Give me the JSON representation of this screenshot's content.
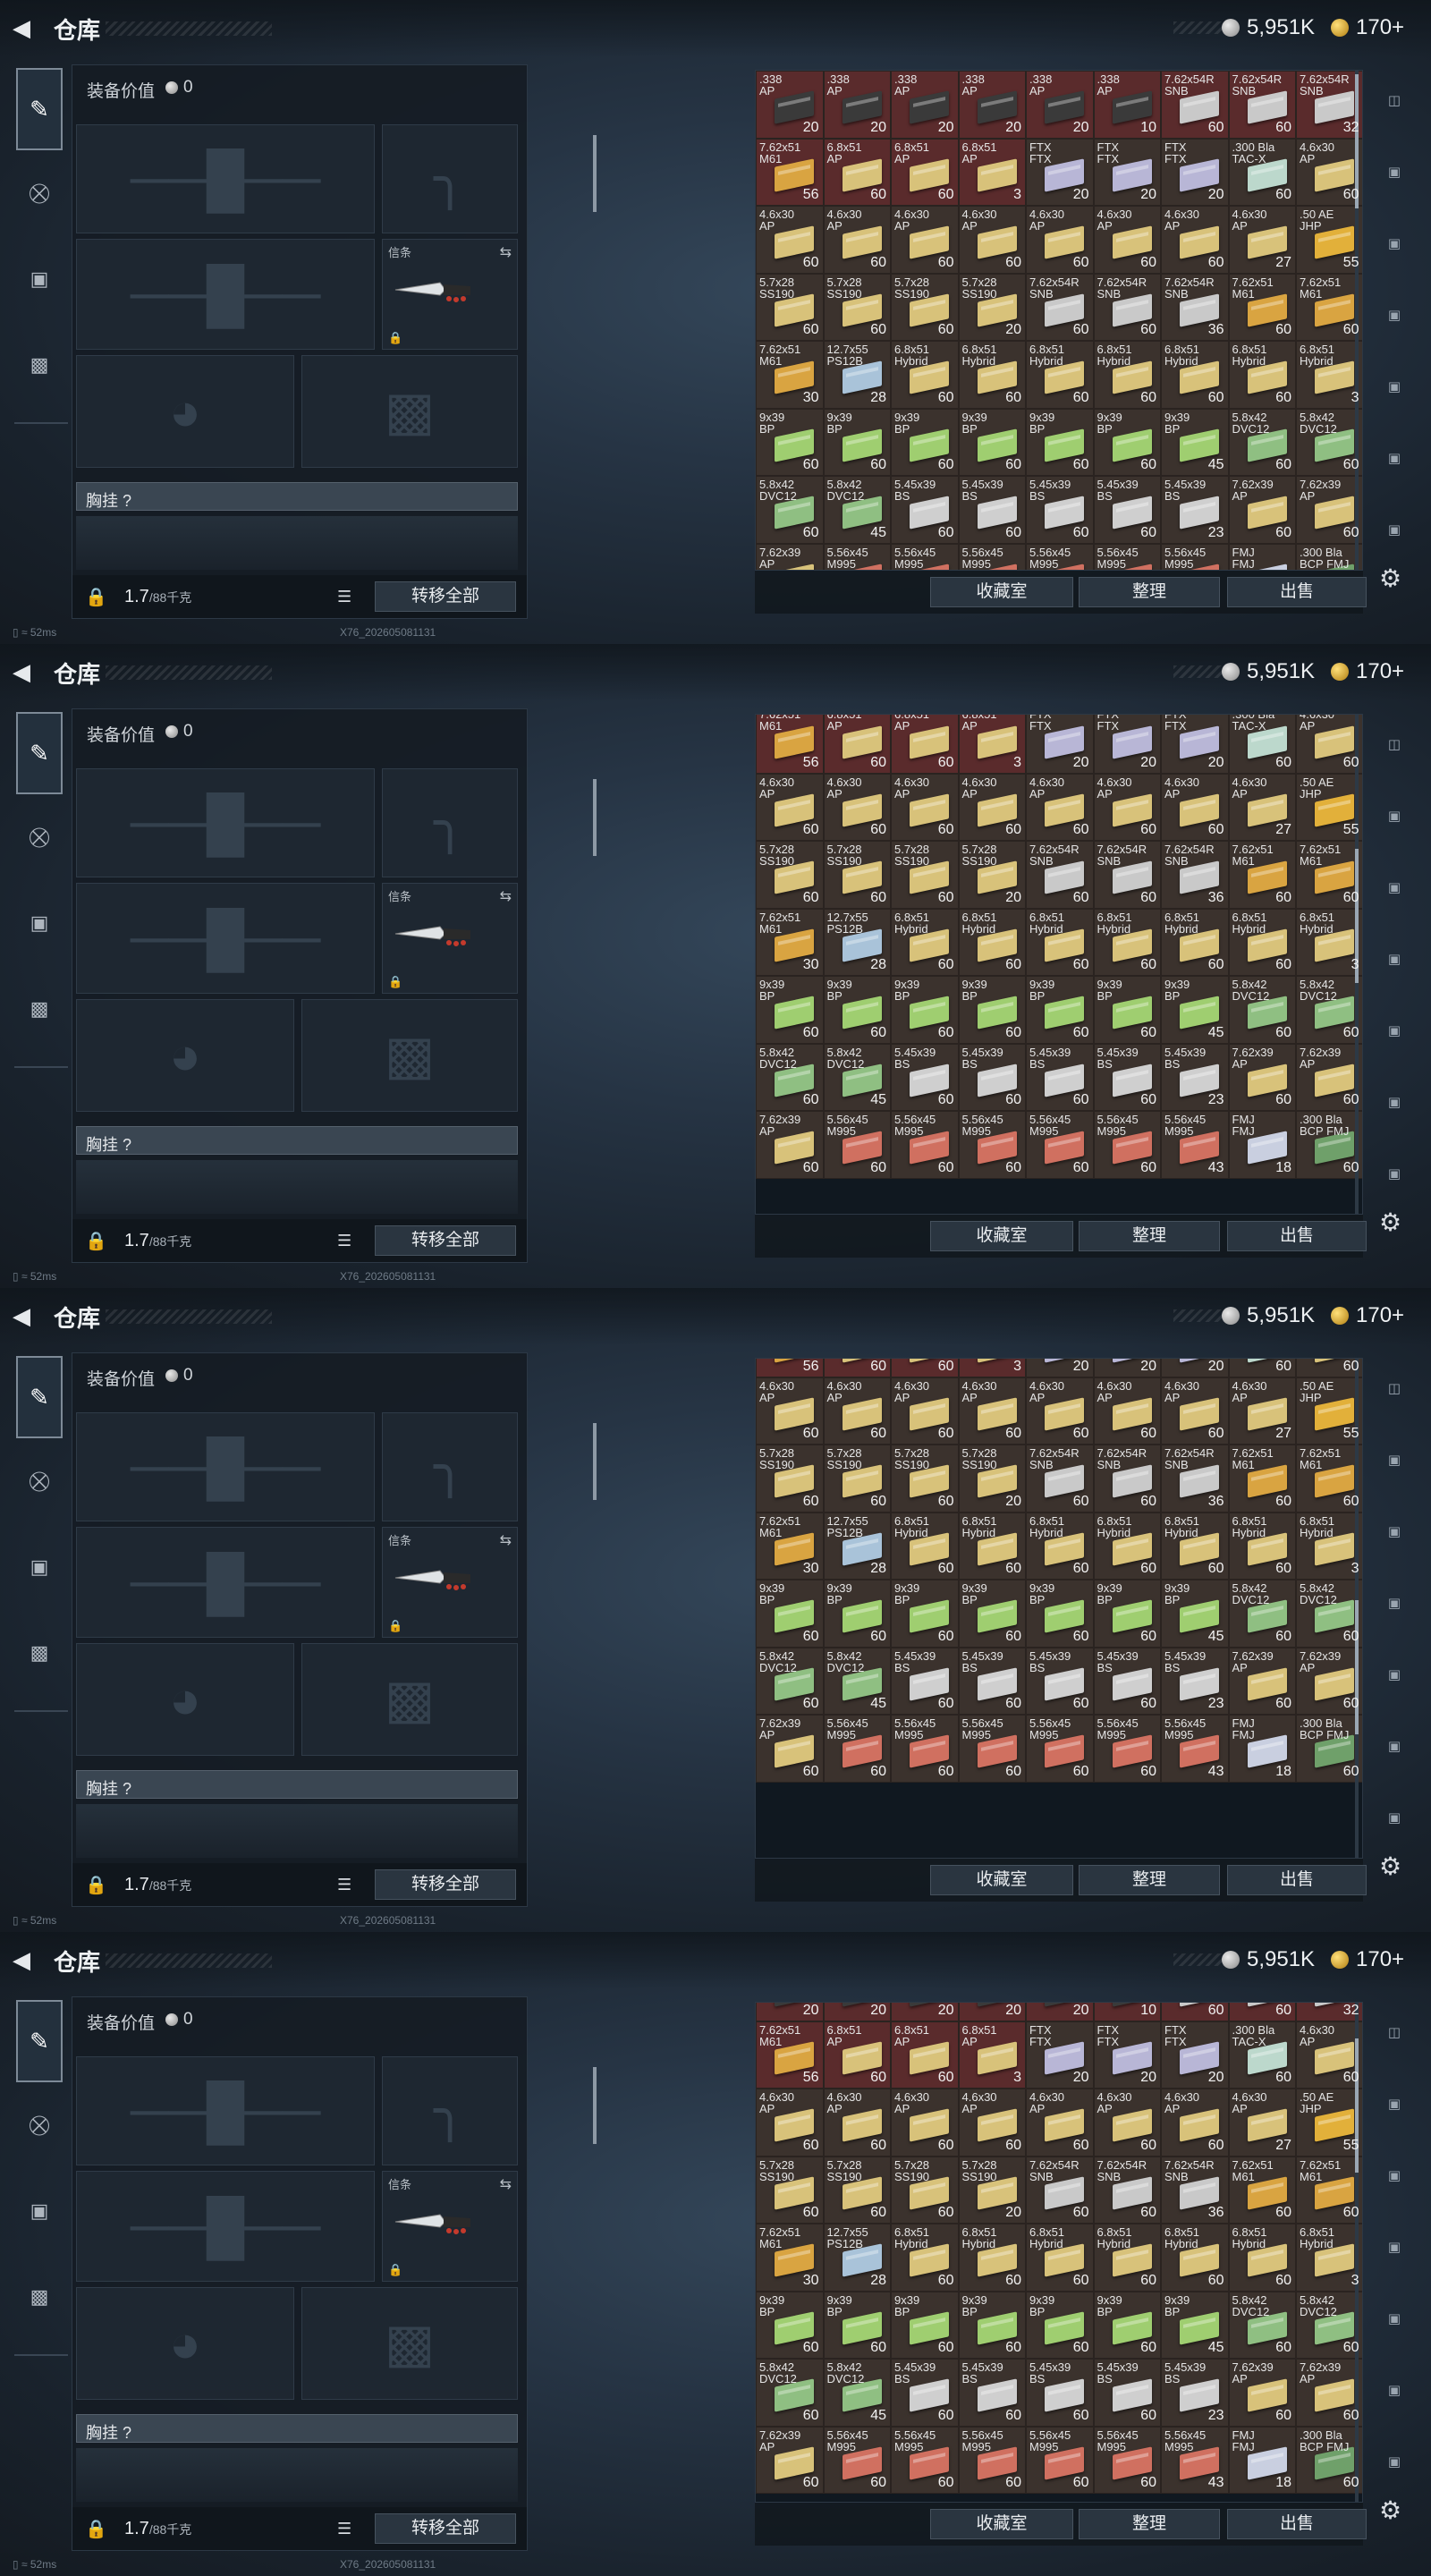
{
  "header": {
    "title": "仓库",
    "silver": "5,951K",
    "gold": "170+"
  },
  "equipment": {
    "value_label": "装备价值",
    "value": "0",
    "melee_tag": "信条",
    "rig_label": "胸挂",
    "rig_help": "?",
    "weight": "1.7",
    "weight_cap": "/88千克",
    "transfer_all": "转移全部"
  },
  "stash_actions": {
    "favorites": "收藏室",
    "sort": "整理",
    "sell": "出售"
  },
  "status": {
    "ping": "52ms",
    "version": "X76_202605081131"
  },
  "items": [
    {
      "n": ".338\nAP",
      "q": "20",
      "c": "#3a3a3a",
      "r": true
    },
    {
      "n": ".338\nAP",
      "q": "20",
      "c": "#3a3a3a",
      "r": true
    },
    {
      "n": ".338\nAP",
      "q": "20",
      "c": "#3a3a3a",
      "r": true
    },
    {
      "n": ".338\nAP",
      "q": "20",
      "c": "#3a3a3a",
      "r": true
    },
    {
      "n": ".338\nAP",
      "q": "20",
      "c": "#3a3a3a",
      "r": true
    },
    {
      "n": ".338\nAP",
      "q": "10",
      "c": "#3a3a3a",
      "r": true
    },
    {
      "n": "7.62x54R\nSNB",
      "q": "60",
      "c": "#c9c9c9",
      "r": true
    },
    {
      "n": "7.62x54R\nSNB",
      "q": "60",
      "c": "#c9c9c9",
      "r": true
    },
    {
      "n": "7.62x54R\nSNB",
      "q": "32",
      "c": "#c9c9c9",
      "r": true
    },
    {
      "n": "7.62x51\nM61",
      "q": "56",
      "c": "#d9a441",
      "r": true
    },
    {
      "n": "6.8x51\nAP",
      "q": "60",
      "c": "#d8c27a",
      "r": true
    },
    {
      "n": "6.8x51\nAP",
      "q": "60",
      "c": "#d8c27a",
      "r": true
    },
    {
      "n": "6.8x51\nAP",
      "q": "3",
      "c": "#d8c27a",
      "r": true
    },
    {
      "n": "FTX\nFTX",
      "q": "20",
      "c": "#b8b6d6",
      "r": false
    },
    {
      "n": "FTX\nFTX",
      "q": "20",
      "c": "#b8b6d6",
      "r": false
    },
    {
      "n": "FTX\nFTX",
      "q": "20",
      "c": "#b8b6d6",
      "r": false
    },
    {
      "n": ".300 Bla\nTAC-X",
      "q": "60",
      "c": "#bcd8cc",
      "r": false
    },
    {
      "n": "4.6x30\nAP",
      "q": "60",
      "c": "#d8c27a",
      "r": false
    },
    {
      "n": "4.6x30\nAP",
      "q": "60",
      "c": "#d8c27a",
      "r": false
    },
    {
      "n": "4.6x30\nAP",
      "q": "60",
      "c": "#d8c27a",
      "r": false
    },
    {
      "n": "4.6x30\nAP",
      "q": "60",
      "c": "#d8c27a",
      "r": false
    },
    {
      "n": "4.6x30\nAP",
      "q": "60",
      "c": "#d8c27a",
      "r": false
    },
    {
      "n": "4.6x30\nAP",
      "q": "60",
      "c": "#d8c27a",
      "r": false
    },
    {
      "n": "4.6x30\nAP",
      "q": "60",
      "c": "#d8c27a",
      "r": false
    },
    {
      "n": "4.6x30\nAP",
      "q": "60",
      "c": "#d8c27a",
      "r": false
    },
    {
      "n": "4.6x30\nAP",
      "q": "27",
      "c": "#d8c27a",
      "r": false
    },
    {
      "n": ".50 AE\nJHP",
      "q": "55",
      "c": "#e2b03a",
      "r": false
    },
    {
      "n": "5.7x28\nSS190",
      "q": "60",
      "c": "#d8c27a",
      "r": false
    },
    {
      "n": "5.7x28\nSS190",
      "q": "60",
      "c": "#d8c27a",
      "r": false
    },
    {
      "n": "5.7x28\nSS190",
      "q": "60",
      "c": "#d8c27a",
      "r": false
    },
    {
      "n": "5.7x28\nSS190",
      "q": "20",
      "c": "#d8c27a",
      "r": false
    },
    {
      "n": "7.62x54R\nSNB",
      "q": "60",
      "c": "#c9c9c9",
      "r": false
    },
    {
      "n": "7.62x54R\nSNB",
      "q": "60",
      "c": "#c9c9c9",
      "r": false
    },
    {
      "n": "7.62x54R\nSNB",
      "q": "36",
      "c": "#c9c9c9",
      "r": false
    },
    {
      "n": "7.62x51\nM61",
      "q": "60",
      "c": "#d9a441",
      "r": false
    },
    {
      "n": "7.62x51\nM61",
      "q": "60",
      "c": "#d9a441",
      "r": false
    },
    {
      "n": "7.62x51\nM61",
      "q": "30",
      "c": "#d9a441",
      "r": false
    },
    {
      "n": "12.7x55\nPS12B",
      "q": "28",
      "c": "#a9c3d9",
      "r": false
    },
    {
      "n": "6.8x51\nHybrid",
      "q": "60",
      "c": "#d8c27a",
      "r": false
    },
    {
      "n": "6.8x51\nHybrid",
      "q": "60",
      "c": "#d8c27a",
      "r": false
    },
    {
      "n": "6.8x51\nHybrid",
      "q": "60",
      "c": "#d8c27a",
      "r": false
    },
    {
      "n": "6.8x51\nHybrid",
      "q": "60",
      "c": "#d8c27a",
      "r": false
    },
    {
      "n": "6.8x51\nHybrid",
      "q": "60",
      "c": "#d8c27a",
      "r": false
    },
    {
      "n": "6.8x51\nHybrid",
      "q": "60",
      "c": "#d8c27a",
      "r": false
    },
    {
      "n": "6.8x51\nHybrid",
      "q": "3",
      "c": "#d8c27a",
      "r": false
    },
    {
      "n": "9x39\nBP",
      "q": "60",
      "c": "#9fce70",
      "r": false
    },
    {
      "n": "9x39\nBP",
      "q": "60",
      "c": "#9fce70",
      "r": false
    },
    {
      "n": "9x39\nBP",
      "q": "60",
      "c": "#9fce70",
      "r": false
    },
    {
      "n": "9x39\nBP",
      "q": "60",
      "c": "#9fce70",
      "r": false
    },
    {
      "n": "9x39\nBP",
      "q": "60",
      "c": "#9fce70",
      "r": false
    },
    {
      "n": "9x39\nBP",
      "q": "60",
      "c": "#9fce70",
      "r": false
    },
    {
      "n": "9x39\nBP",
      "q": "45",
      "c": "#9fce70",
      "r": false
    },
    {
      "n": "5.8x42\nDVC12",
      "q": "60",
      "c": "#8fbf82",
      "r": false
    },
    {
      "n": "5.8x42\nDVC12",
      "q": "60",
      "c": "#8fbf82",
      "r": false
    },
    {
      "n": "5.8x42\nDVC12",
      "q": "60",
      "c": "#8fbf82",
      "r": false
    },
    {
      "n": "5.8x42\nDVC12",
      "q": "45",
      "c": "#8fbf82",
      "r": false
    },
    {
      "n": "5.45x39\nBS",
      "q": "60",
      "c": "#cfcfcf",
      "r": false
    },
    {
      "n": "5.45x39\nBS",
      "q": "60",
      "c": "#cfcfcf",
      "r": false
    },
    {
      "n": "5.45x39\nBS",
      "q": "60",
      "c": "#cfcfcf",
      "r": false
    },
    {
      "n": "5.45x39\nBS",
      "q": "60",
      "c": "#cfcfcf",
      "r": false
    },
    {
      "n": "5.45x39\nBS",
      "q": "23",
      "c": "#cfcfcf",
      "r": false
    },
    {
      "n": "7.62x39\nAP",
      "q": "60",
      "c": "#d8c27a",
      "r": false
    },
    {
      "n": "7.62x39\nAP",
      "q": "60",
      "c": "#d8c27a",
      "r": false
    },
    {
      "n": "7.62x39\nAP",
      "q": "60",
      "c": "#d8c27a",
      "r": false
    },
    {
      "n": "5.56x45\nM995",
      "q": "60",
      "c": "#d07060",
      "r": false
    },
    {
      "n": "5.56x45\nM995",
      "q": "60",
      "c": "#d07060",
      "r": false
    },
    {
      "n": "5.56x45\nM995",
      "q": "60",
      "c": "#d07060",
      "r": false
    },
    {
      "n": "5.56x45\nM995",
      "q": "60",
      "c": "#d07060",
      "r": false
    },
    {
      "n": "5.56x45\nM995",
      "q": "60",
      "c": "#d07060",
      "r": false
    },
    {
      "n": "5.56x45\nM995",
      "q": "43",
      "c": "#d07060",
      "r": false
    },
    {
      "n": "FMJ\nFMJ",
      "q": "18",
      "c": "#c9cfe0",
      "r": false
    },
    {
      "n": ".300 Bla\nBCP FMJ",
      "q": "60",
      "c": "#6fa06a",
      "r": false
    }
  ]
}
